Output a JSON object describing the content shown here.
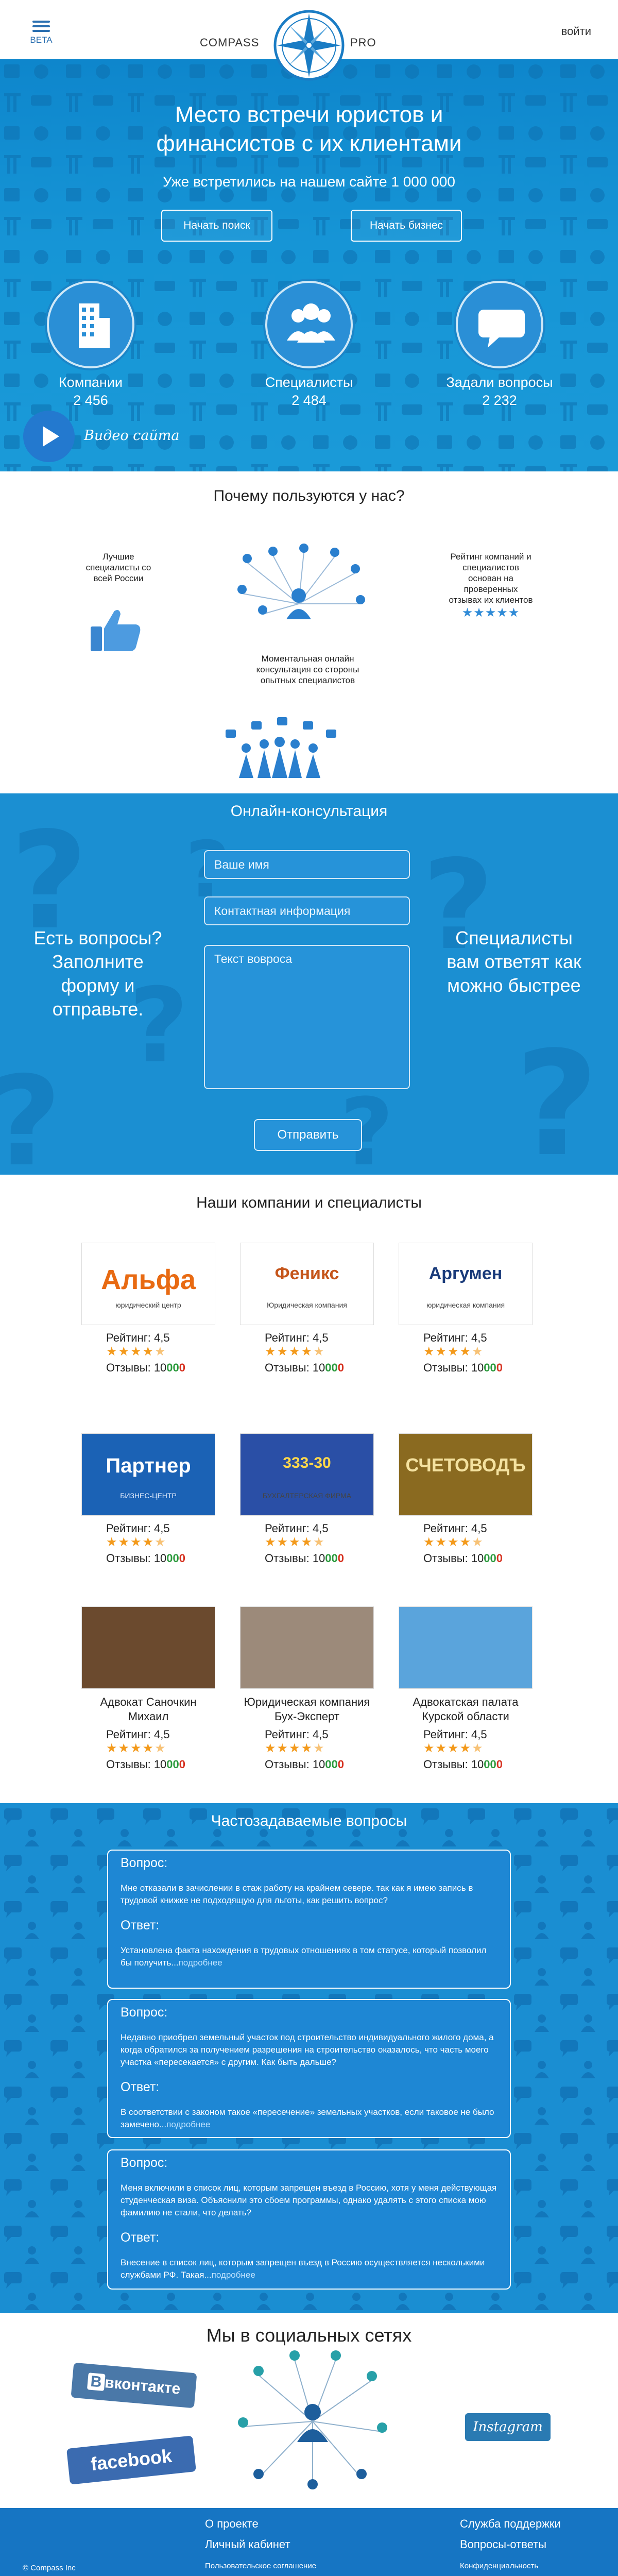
{
  "header": {
    "beta": "BETA",
    "brand_left": "COMPASS",
    "brand_right": "PRO",
    "login": "войти"
  },
  "hero": {
    "title_line1": "Место встречи юристов и",
    "title_line2": "финансистов с их клиентами",
    "met_label": "Уже встретились на нашем сайте  1 000 000",
    "btn_search": "Начать поиск",
    "btn_business": "Начать бизнес",
    "stats": [
      {
        "label": "Компании",
        "value": "2 456",
        "icon": "building-icon"
      },
      {
        "label": "Специалисты",
        "value": "2 484",
        "icon": "people-icon"
      },
      {
        "label": "Задали вопросы",
        "value": "2 232",
        "icon": "speech-bubble-icon"
      }
    ],
    "video_label": "Видео сайта"
  },
  "why": {
    "title": "Почему пользуются у нас?",
    "items": [
      "Лучшие специалисты со всей России",
      "Рейтинг компаний и специалистов основан на проверенных отзывах их клиентов",
      "Моментальная онлайн консультация со стороны опытных специалистов"
    ]
  },
  "consult": {
    "title": "Онлайн-консультация",
    "name_placeholder": "Ваше имя",
    "contact_placeholder": "Контактная информация",
    "question_placeholder": "Текст вовроса",
    "left_text": "Есть вопросы? Заполните форму и отправьте.",
    "right_text": "Специалисты вам ответят как можно быстрее",
    "send_label": "Отправить"
  },
  "companies": {
    "title": "Наши компании и специалисты",
    "rating_label": "Рейтинг: 4,5",
    "reviews_label": "Отзывы: 10",
    "reviews_pos": "00",
    "reviews_neg": "0",
    "items": [
      {
        "logo_text": "Альфа",
        "logo_sub": "юридический центр",
        "name": ""
      },
      {
        "logo_text": "Феникс",
        "logo_sub": "Юридическая компания",
        "name": ""
      },
      {
        "logo_text": "Аргумен",
        "logo_sub": "юридическая компания",
        "name": ""
      },
      {
        "logo_text": "Партнер",
        "logo_sub": "БИЗНЕС-ЦЕНТР",
        "name": ""
      },
      {
        "logo_text": "333-30",
        "logo_sub": "БУХГАЛТЕРСКАЯ ФИРМА",
        "name": ""
      },
      {
        "logo_text": "СЧЕТОВОДЪ",
        "logo_sub": "",
        "name": ""
      },
      {
        "logo_text": "",
        "logo_sub": "",
        "name": "Адвокат Саночкин Михаил"
      },
      {
        "logo_text": "",
        "logo_sub": "",
        "name": "Юридическая компания Бух-Эксперт"
      },
      {
        "logo_text": "",
        "logo_sub": "",
        "name": "Адвокатская палата Курской области"
      }
    ]
  },
  "faq": {
    "title": "Частозадаваемые вопросы",
    "q_label": "Вопрос:",
    "a_label": "Ответ:",
    "more": "подробнее",
    "items": [
      {
        "q": "Мне отказали в зачислении в стаж работу на крайнем севере. так как я имею запись в трудовой книжке не подходящую для льготы, как решить вопрос?",
        "a": "Установлена факта нахождения в трудовых отношениях в том статусе, который позволил бы получить..."
      },
      {
        "q": "Недавно приобрел земельный участок под строительство индивидуального жилого дома, а когда обратился за получением разрешения на строительство оказалось, что часть моего участка «пересекается» с другим. Как быть дальше?",
        "a": "В соответствии с законом такое «пересечение» земельных участков, если таковое не было замечено..."
      },
      {
        "q": "Меня включили в список лиц, которым запрещен въезд в Россию, хотя у меня действующая студенческая виза. Объяснили это сбоем программы, однако удалять с этого списка мою фамилию не стали, что делать?",
        "a": "Внесение в список лиц, которым запрещен въезд в Россию осуществляется несколькими службами РФ. Такая..."
      }
    ]
  },
  "social": {
    "title": "Мы в социальных сетях",
    "vk": "вконтакте",
    "vk_prefix": "В",
    "fb": "facebook",
    "insta": "Instagram"
  },
  "footer": {
    "about": "О проекте",
    "cabinet": "Личный кабинет",
    "agreement": "Пользовательское соглашение",
    "support": "Служба поддержки",
    "qa": "Вопросы-ответы",
    "privacy": "Конфиденциальность",
    "copyright": "© Compass Inc"
  },
  "colors": {
    "brand_blue": "#1a8ed2",
    "footer_blue": "#1675c3",
    "star_orange": "#f39a1c"
  }
}
